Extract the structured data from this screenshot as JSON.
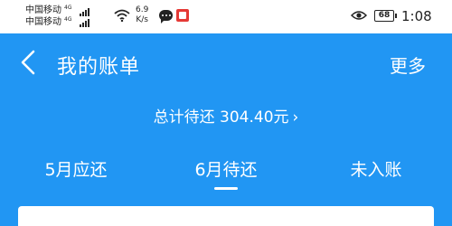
{
  "status_bar": {
    "carrier_1": "中国移动",
    "carrier_2": "中国移动",
    "network_type_1": "4G",
    "network_type_2": "4G",
    "speed_value": "6.9",
    "speed_unit": "K/s",
    "battery": "68",
    "time": "1:08",
    "icons": [
      "signal-icon",
      "wifi-icon",
      "chat-icon",
      "book-app-icon",
      "eye-icon",
      "battery-icon"
    ]
  },
  "nav": {
    "title": "我的账单",
    "more_label": "更多"
  },
  "summary": {
    "total_text": "总计待还 304.40元",
    "chevron": "›"
  },
  "tabs": [
    {
      "label": "5月应还"
    },
    {
      "label": "6月待还",
      "selected": true
    },
    {
      "label": "未入账"
    }
  ],
  "colors": {
    "primary": "#2196F3",
    "status_bar_bg": "#ffffff",
    "accent_red": "#e53935"
  }
}
